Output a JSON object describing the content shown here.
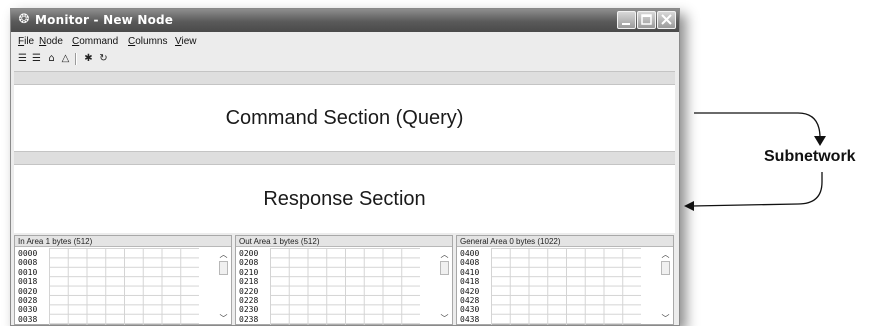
{
  "window": {
    "title": "Monitor - New Node",
    "title_icon": "monitor-app-icon"
  },
  "menu": [
    {
      "ul": "F",
      "rest": "ile"
    },
    {
      "ul": "N",
      "rest": "ode"
    },
    {
      "ul": "C",
      "rest": "ommand"
    },
    {
      "ul": "C",
      "rest": "olumns"
    },
    {
      "ul": "V",
      "rest": "iew"
    }
  ],
  "toolbar_icons": [
    "connect-icon",
    "disconnect-icon",
    "node-config-icon",
    "warning-icon",
    "bug-icon",
    "refresh-icon"
  ],
  "command_section": "Command Section (Query)",
  "response_section": "Response Section",
  "areas": [
    {
      "header": "In Area 1 bytes (512)",
      "addresses": [
        "0000",
        "0008",
        "0010",
        "0018",
        "0020",
        "0028",
        "0030",
        "0038"
      ]
    },
    {
      "header": "Out Area 1 bytes (512)",
      "addresses": [
        "0200",
        "0208",
        "0210",
        "0218",
        "0220",
        "0228",
        "0230",
        "0238"
      ]
    },
    {
      "header": "General Area 0 bytes (1022)",
      "addresses": [
        "0400",
        "0408",
        "0410",
        "0418",
        "0420",
        "0428",
        "0430",
        "0438"
      ]
    }
  ],
  "annotation": {
    "label": "Subnetwork"
  },
  "colors": {
    "titlebar": "#5a5a5a",
    "pane_background": "#ffffff",
    "strip": "#dedede"
  }
}
